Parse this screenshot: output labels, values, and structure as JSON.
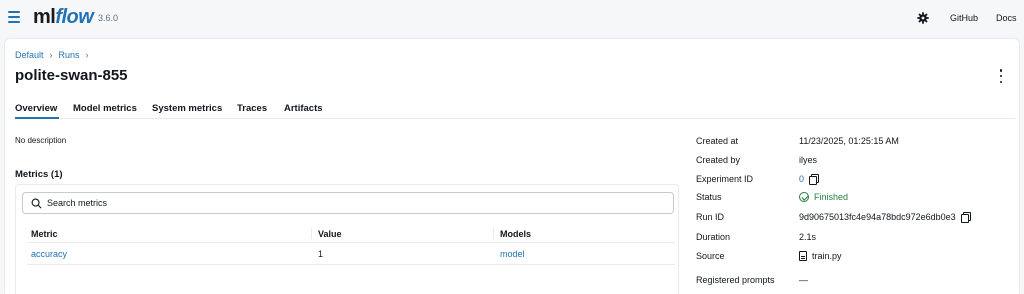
{
  "header": {
    "logo_ml": "ml",
    "logo_flow": "flow",
    "version": "3.6.0",
    "links": [
      "GitHub",
      "Docs"
    ]
  },
  "breadcrumb": {
    "items": [
      "Default",
      "Runs"
    ],
    "separator": "›"
  },
  "run": {
    "title": "polite-swan-855"
  },
  "tabs": [
    "Overview",
    "Model metrics",
    "System metrics",
    "Traces",
    "Artifacts"
  ],
  "overview": {
    "description": "No description",
    "metrics_heading": "Metrics (1)",
    "search_placeholder": "Search metrics",
    "table": {
      "columns": [
        "Metric",
        "Value",
        "Models"
      ],
      "rows": [
        {
          "metric": "accuracy",
          "value": "1",
          "model": "model"
        }
      ]
    }
  },
  "details": {
    "created_at": {
      "label": "Created at",
      "value": "11/23/2025, 01:25:15 AM"
    },
    "created_by": {
      "label": "Created by",
      "value": "ilyes"
    },
    "experiment_id": {
      "label": "Experiment ID",
      "value": "0"
    },
    "status": {
      "label": "Status",
      "value": "Finished"
    },
    "run_id": {
      "label": "Run ID",
      "value": "9d90675013fc4e94a78bdc972e6db0e3"
    },
    "duration": {
      "label": "Duration",
      "value": "2.1s"
    },
    "source": {
      "label": "Source",
      "value": "train.py"
    },
    "registered_prompts": {
      "label": "Registered prompts",
      "value": "—"
    }
  },
  "colors": {
    "accent": "#2272b4",
    "success": "#277c43",
    "background": "#f6f7f9"
  }
}
